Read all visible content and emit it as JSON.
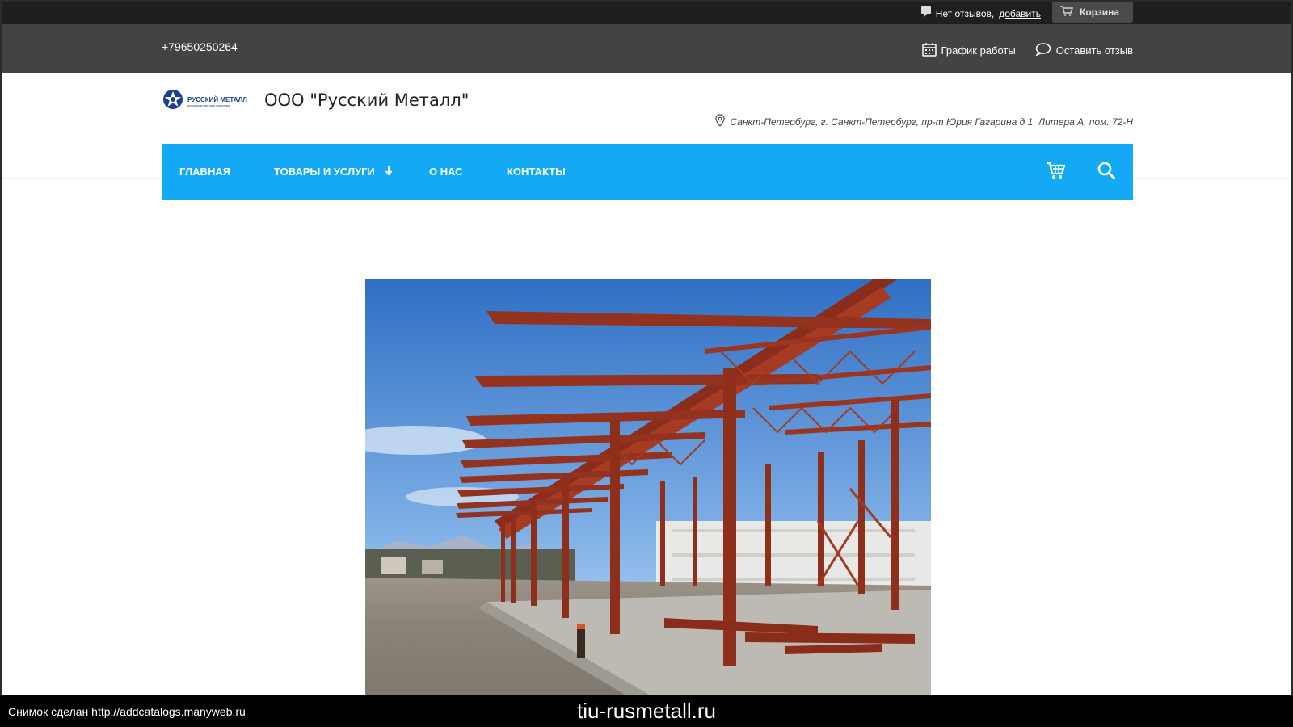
{
  "topbar": {
    "reviews_text": "Нет отзывов,",
    "reviews_link": "добавить",
    "cart_label": "Корзина"
  },
  "header": {
    "phone": "+79650250264",
    "schedule_label": "График работы",
    "review_label": "Оставить отзыв"
  },
  "brand": {
    "logo_text": "РУССКИЙ МЕТАЛЛ",
    "logo_subtext": "производственная компания",
    "company_name": "ООО \"Русский Металл\"",
    "address": "Санкт-Петербург, г. Санкт-Петербург, пр-т Юрия Гагарина д.1, Литера А, пом. 72-Н"
  },
  "nav": {
    "items": [
      {
        "label": "Главная"
      },
      {
        "label": "Товары и услуги"
      },
      {
        "label": "О нас"
      },
      {
        "label": "Контакты"
      }
    ]
  },
  "colors": {
    "nav_bg": "#14a9f5",
    "header_dark": "#434343",
    "topbar": "#1f1f1f",
    "logo_blue": "#1d3f8f"
  },
  "caption": {
    "left": "Снимок сделан http://addcatalogs.manyweb.ru",
    "center": "tiu-rusmetall.ru"
  }
}
